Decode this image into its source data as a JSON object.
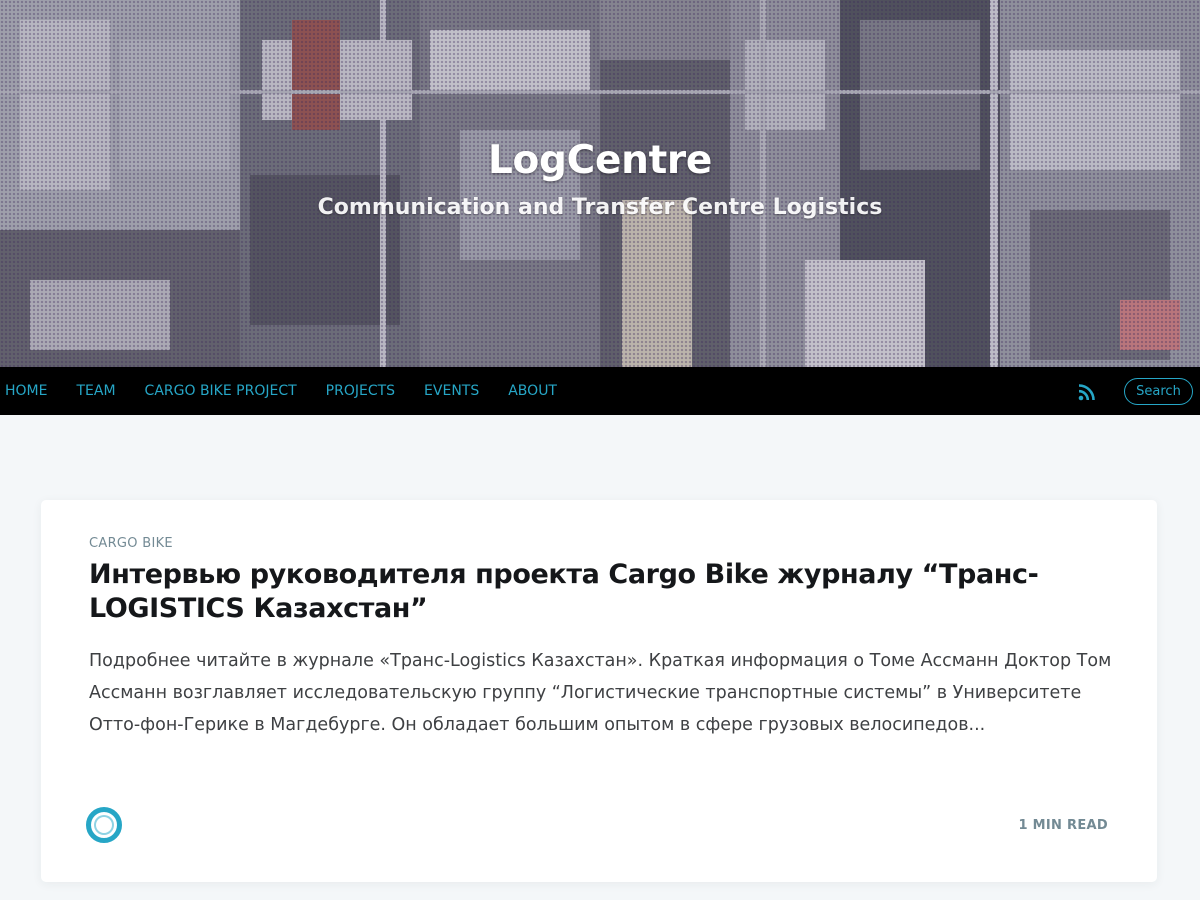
{
  "header": {
    "site_title": "LogCentre",
    "site_description": "Communication and Transfer Centre Logistics"
  },
  "nav": {
    "items": [
      {
        "label": "HOME"
      },
      {
        "label": "TEAM"
      },
      {
        "label": "CARGO BIKE PROJECT"
      },
      {
        "label": "PROJECTS"
      },
      {
        "label": "EVENTS"
      },
      {
        "label": "ABOUT"
      }
    ],
    "rss_icon": "rss-icon",
    "search_label": "Search"
  },
  "post": {
    "tag": "CARGO BIKE",
    "title": "Интервью руководителя проекта Cargo Bike журналу “Транс-LOGISTICS Казахстан”",
    "excerpt": "Подробнее читайте в журнале «Транс-Logistics Казахстан». Краткая информация о Томе Ассманн Доктор Том Ассманн возглавляет исследовательскую группу “Логистические транспортные системы” в Университете Отто-фон-Герике в Магдебурге. Он обладает большим опытом в сфере грузовых велосипедов...",
    "reading_time": "1 MIN READ",
    "author_avatar": "avatar-icon"
  },
  "colors": {
    "accent": "#26a6c6",
    "nav_background": "#000000",
    "page_background": "#f4f7f9",
    "meta_text": "#738a94"
  }
}
